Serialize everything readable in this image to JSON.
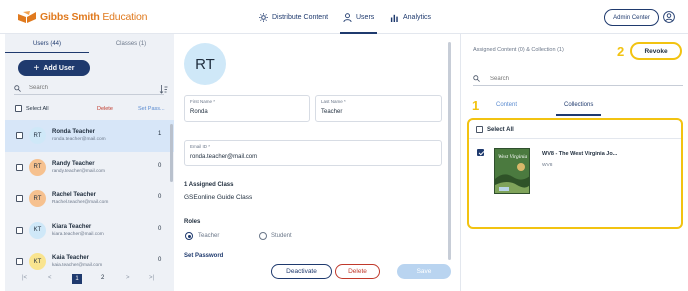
{
  "brand": {
    "name_bold": "Gibbs Smith",
    "name_light": " Education",
    "accent": "#e07a1f"
  },
  "nav": {
    "items": [
      {
        "label": "Distribute Content",
        "icon": "sun-icon"
      },
      {
        "label": "Users",
        "icon": "user-icon",
        "active": true
      },
      {
        "label": "Analytics",
        "icon": "bar-chart-icon"
      }
    ],
    "admin_center": "Admin Center"
  },
  "left": {
    "tabs": [
      {
        "label": "Users (44)",
        "active": true
      },
      {
        "label": "Classes (1)"
      }
    ],
    "add_user": "Add User",
    "search_placeholder": "Search",
    "select_all": "Select All",
    "delete": "Delete",
    "set_password": "Set Pass...",
    "users": [
      {
        "initials": "RT",
        "name": "Ronda Teacher",
        "email": "ronda.teacher@mail.com",
        "count": "1",
        "color": "#cfe8f8",
        "selected": true
      },
      {
        "initials": "RT",
        "name": "Randy Teacher",
        "email": "randy.teacher@mail.com",
        "count": "0",
        "color": "#f6c18f"
      },
      {
        "initials": "RT",
        "name": "Rachel Teacher",
        "email": "Rachel.teacher@mail.com",
        "count": "0",
        "color": "#f6c18f"
      },
      {
        "initials": "KT",
        "name": "Kiara Teacher",
        "email": "kiara.teacher@mail.com",
        "count": "0",
        "color": "#cfe8f8"
      },
      {
        "initials": "KT",
        "name": "Kaia Teacher",
        "email": "kaia.teacher@mail.com",
        "count": "0",
        "color": "#f9e48f"
      }
    ],
    "pager": {
      "first": "|<",
      "prev": "<",
      "page1": "1",
      "page2": "2",
      "next": ">",
      "last": ">|"
    }
  },
  "detail": {
    "initials": "RT",
    "first_name_label": "First Name *",
    "first_name": "Ronda",
    "last_name_label": "Last Name *",
    "last_name": "Teacher",
    "email_label": "Email ID *",
    "email": "ronda.teacher@mail.com",
    "assigned_class_heading": "1 Assigned Class",
    "class_name": "GSEonline Guide Class",
    "roles_heading": "Roles",
    "role_teacher": "Teacher",
    "role_student": "Student",
    "set_password": "Set Password",
    "deactivate": "Deactivate",
    "delete": "Delete",
    "save": "Save"
  },
  "right": {
    "assigned_content": "Assigned Content (0) & Collection (1)",
    "revoke": "Revoke",
    "badge_1": "1",
    "badge_2": "2",
    "highlight_color": "#f2c311",
    "search_placeholder": "Search",
    "tab_content": "Content",
    "tab_collections": "Collections",
    "select_all": "Select All",
    "item_title": "WV8 - The West Virginia Jo...",
    "item_sub": "WV8",
    "book_cover_text": "West Virginia"
  }
}
